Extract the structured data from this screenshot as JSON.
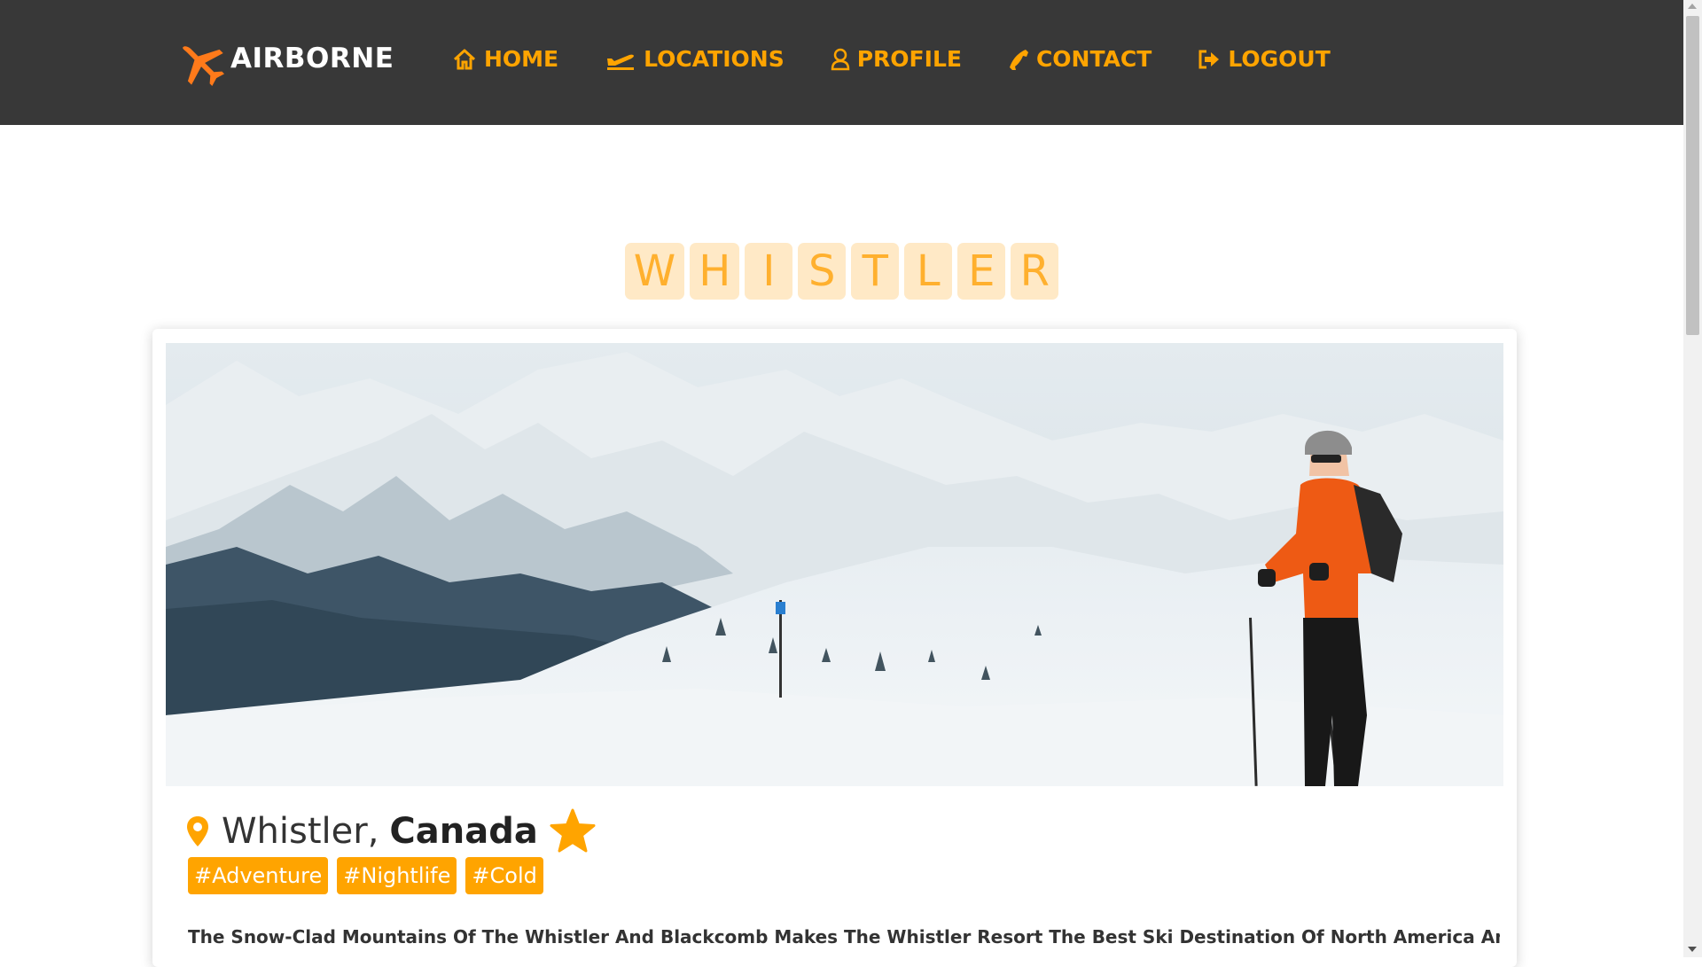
{
  "brand": {
    "name": "AIRBORNE",
    "icon": "airplane-icon",
    "color": "#ff7a1a"
  },
  "nav": {
    "items": [
      {
        "label": "HOME",
        "icon": "home-icon"
      },
      {
        "label": "LOCATIONS",
        "icon": "plane-departure-icon"
      },
      {
        "label": "PROFILE",
        "icon": "user-icon"
      },
      {
        "label": "CONTACT",
        "icon": "phone-icon"
      },
      {
        "label": "LOGOUT",
        "icon": "sign-out-icon"
      }
    ],
    "accent": "#ffa400",
    "background": "#383838"
  },
  "title_letters": [
    "W",
    "H",
    "I",
    "S",
    "T",
    "L",
    "E",
    "R"
  ],
  "destination": {
    "city": "Whistler,",
    "country": "Canada",
    "tags": [
      "#Adventure",
      "#Nightlife",
      "#Cold"
    ],
    "description": "The Snow-Clad Mountains Of The Whistler And Blackcomb Makes The Whistler Resort The Best Ski Destination Of North America And One Of"
  }
}
